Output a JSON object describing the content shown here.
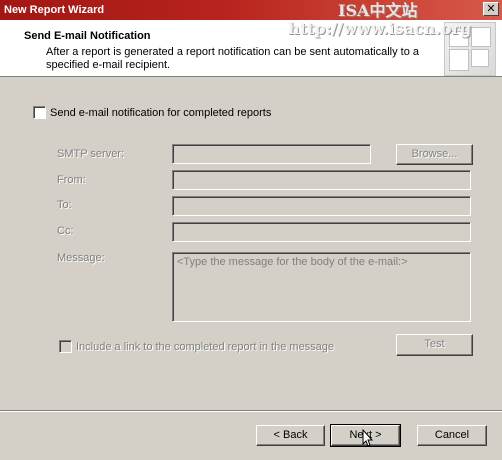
{
  "window": {
    "title": "New Report Wizard"
  },
  "header": {
    "title": "Send E-mail Notification",
    "description": "After a report is generated a report notification can be sent automatically to a specified e-mail recipient.",
    "watermark_line1": "ISA中文站",
    "watermark_line2": "http://www.isacn.org"
  },
  "form": {
    "send_notification_label": "Send e-mail notification for completed reports",
    "send_notification_checked": false,
    "smtp_label": "SMTP server:",
    "smtp_value": "",
    "browse_label": "Browse...",
    "from_label": "From:",
    "from_value": "",
    "to_label": "To:",
    "to_value": "",
    "cc_label": "Cc:",
    "cc_value": "",
    "message_label": "Message:",
    "message_placeholder": "<Type the message for the body of the e-mail:>",
    "include_link_label": "Include a link to the completed report in the message",
    "include_link_checked": false,
    "test_label": "Test"
  },
  "footer": {
    "back_label": "< Back",
    "next_label": "Next >",
    "cancel_label": "Cancel"
  }
}
